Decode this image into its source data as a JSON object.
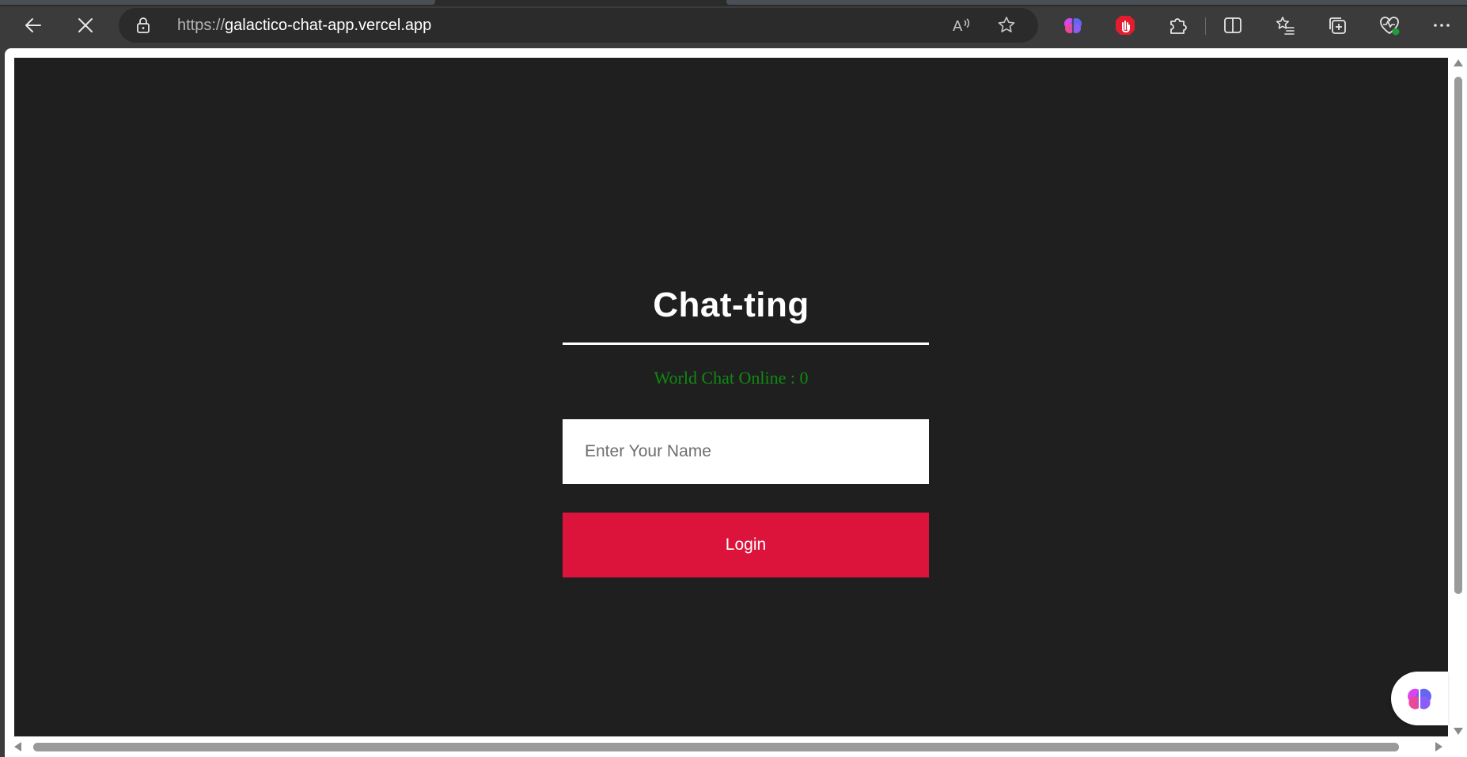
{
  "browser": {
    "url_scheme": "https://",
    "url_host": "galactico-chat-app.vercel.app",
    "icons": {
      "back": "back-arrow-icon",
      "stop": "close-icon",
      "lock": "lock-icon",
      "read_aloud": "read-aloud-icon",
      "favorite": "star-icon",
      "ext_brain": "brain-icon",
      "ext_stop": "stop-hand-icon",
      "extensions": "puzzle-icon",
      "split": "split-screen-icon",
      "favorites": "favorites-list-icon",
      "collections": "collections-icon",
      "health": "browser-essentials-icon",
      "more": "more-icon"
    }
  },
  "app": {
    "title": "Chat-ting",
    "online_text": "World Chat Online : 0",
    "name_placeholder": "Enter Your Name",
    "login_label": "Login",
    "colors": {
      "background": "#201f20",
      "accent": "#dc143c",
      "online": "#0f8a0f"
    }
  }
}
